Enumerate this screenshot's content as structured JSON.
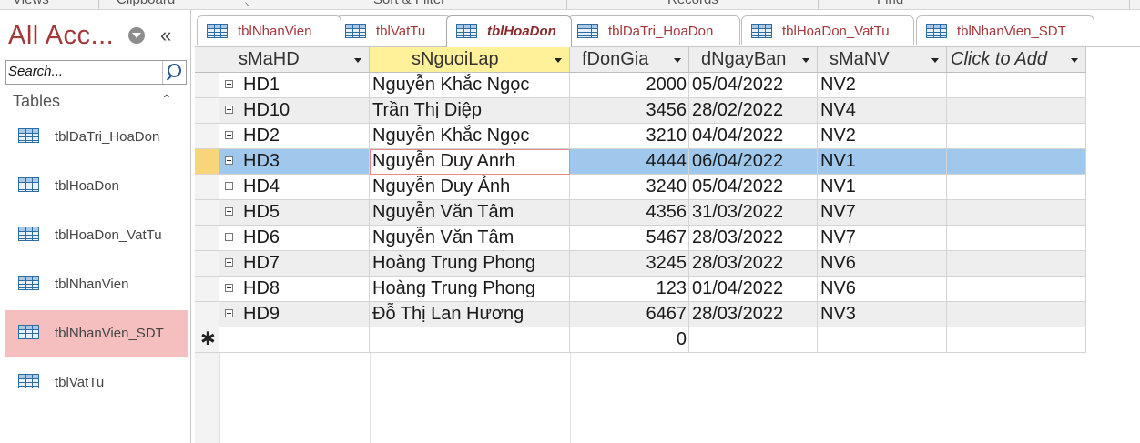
{
  "ribbon": {
    "groups": [
      "Views",
      "Clipboard",
      "Sort & Filter",
      "Records",
      "Find"
    ]
  },
  "nav": {
    "title": "All Acc...",
    "search_placeholder": "Search...",
    "section_label": "Tables",
    "items": [
      {
        "label": "tblDaTri_HoaDon"
      },
      {
        "label": "tblHoaDon"
      },
      {
        "label": "tblHoaDon_VatTu"
      },
      {
        "label": "tblNhanVien"
      },
      {
        "label": "tblNhanVien_SDT",
        "selected": true
      },
      {
        "label": "tblVatTu"
      }
    ]
  },
  "tabs": [
    {
      "label": "tblNhanVien"
    },
    {
      "label": "tblVatTu"
    },
    {
      "label": "tblHoaDon",
      "active": true
    },
    {
      "label": "tblDaTri_HoaDon"
    },
    {
      "label": "tblHoaDon_VatTu"
    },
    {
      "label": "tblNhanVien_SDT"
    }
  ],
  "grid": {
    "columns": [
      "sMaHD",
      "sNguoiLap",
      "fDonGia",
      "dNgayBan",
      "sMaNV",
      "Click to Add"
    ],
    "rows": [
      [
        "HD1",
        "Nguyễn Khắc Ngọc",
        "2000",
        "05/04/2022",
        "NV2"
      ],
      [
        "HD10",
        "Trần Thị Diệp",
        "3456",
        "28/02/2022",
        "NV4"
      ],
      [
        "HD2",
        "Nguyễn Khắc Ngọc",
        "3210",
        "04/04/2022",
        "NV2"
      ],
      [
        "HD3",
        "Nguyễn Duy Anrh",
        "4444",
        "06/04/2022",
        "NV1"
      ],
      [
        "HD4",
        "Nguyễn Duy Ảnh",
        "3240",
        "05/04/2022",
        "NV1"
      ],
      [
        "HD5",
        "Nguyễn Văn Tâm",
        "4356",
        "31/03/2022",
        "NV7"
      ],
      [
        "HD6",
        "Nguyễn Văn Tâm",
        "5467",
        "28/03/2022",
        "NV7"
      ],
      [
        "HD7",
        "Hoàng Trung Phong",
        "3245",
        "28/03/2022",
        "NV6"
      ],
      [
        "HD8",
        "Hoàng Trung Phong",
        "123",
        "01/04/2022",
        "NV6"
      ],
      [
        "HD9",
        "Đỗ Thị Lan Hương",
        "6467",
        "28/03/2022",
        "NV3"
      ]
    ],
    "current_row": 3,
    "new_row_symbol": "✱",
    "new_row_default": "0"
  },
  "colors": {
    "accent": "#a4373a",
    "selected_row": "#9fc8ec",
    "sorted_header": "#fff19a",
    "nav_selected": "#f5bfc0"
  },
  "icons": {
    "table": "table-icon",
    "search": "search-icon",
    "collapse": "double-chevron-left-icon",
    "menu": "chevron-down-circle-icon",
    "expand": "plus-box-icon"
  }
}
